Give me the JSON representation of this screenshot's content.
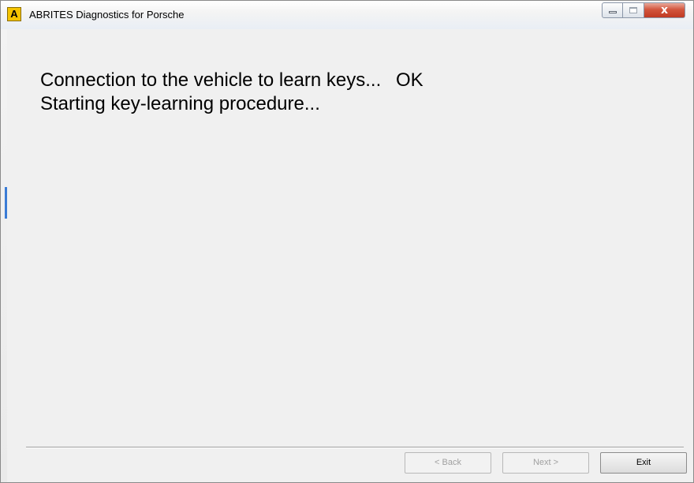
{
  "window": {
    "title": "ABRITES Diagnostics for Porsche",
    "app_icon_letter": "A",
    "close_symbol": "x",
    "accent_color": "#f5c400"
  },
  "main": {
    "line1": "Connection to the vehicle to learn keys...",
    "line1_status": "OK",
    "line2": "Starting key-learning procedure..."
  },
  "footer": {
    "back_label": "< Back",
    "next_label": "Next >",
    "exit_label": "Exit",
    "back_enabled": false,
    "next_enabled": false,
    "exit_enabled": true
  }
}
